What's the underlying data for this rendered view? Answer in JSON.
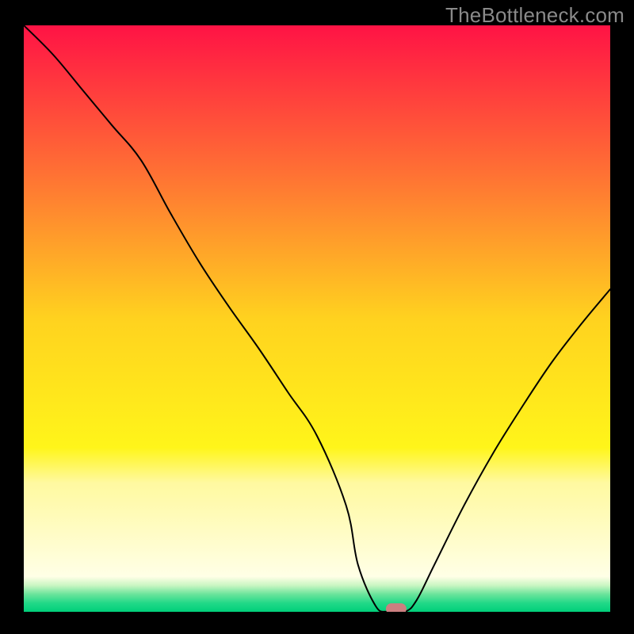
{
  "watermark": "TheBottleneck.com",
  "chart_data": {
    "type": "line",
    "title": "",
    "xlabel": "",
    "ylabel": "",
    "xlim": [
      0,
      100
    ],
    "ylim": [
      0,
      100
    ],
    "x": [
      0,
      5,
      10,
      15,
      20,
      25,
      30,
      35,
      40,
      45,
      50,
      55,
      57,
      60,
      62,
      65,
      67,
      70,
      75,
      80,
      85,
      90,
      95,
      100
    ],
    "values": [
      100,
      95,
      89,
      83,
      77,
      68,
      59.5,
      52,
      45,
      37.5,
      30,
      18,
      8,
      1,
      0,
      0,
      2,
      8,
      18,
      27,
      35,
      42.5,
      49,
      55
    ],
    "marker": {
      "x": 63.5,
      "y": 0.5,
      "color": "#cc7f80"
    },
    "background": {
      "type": "vertical-gradient",
      "stops": [
        {
          "offset": 0.0,
          "color": "#ff1345"
        },
        {
          "offset": 0.25,
          "color": "#ff7034"
        },
        {
          "offset": 0.5,
          "color": "#ffd21f"
        },
        {
          "offset": 0.72,
          "color": "#fff51a"
        },
        {
          "offset": 0.78,
          "color": "#fff9a0"
        },
        {
          "offset": 0.94,
          "color": "#ffffe6"
        },
        {
          "offset": 0.955,
          "color": "#c9f6c2"
        },
        {
          "offset": 0.97,
          "color": "#6be49b"
        },
        {
          "offset": 0.985,
          "color": "#22d988"
        },
        {
          "offset": 1.0,
          "color": "#00cf7a"
        }
      ]
    },
    "frame_color": "#000000",
    "line_color": "#000000",
    "line_width": 2
  }
}
